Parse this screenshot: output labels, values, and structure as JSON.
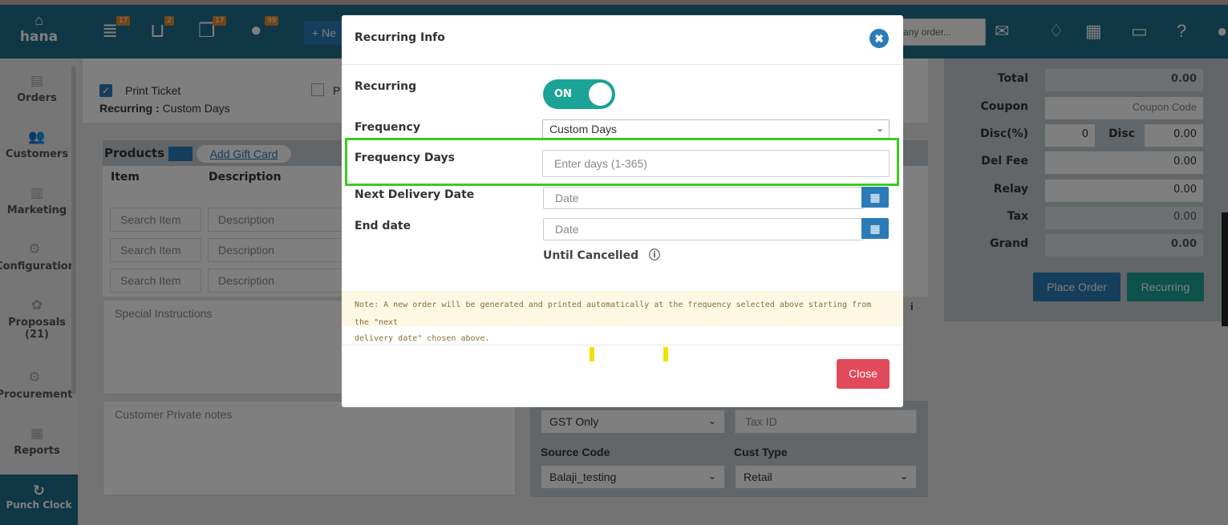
{
  "app": {
    "brand": "hana"
  },
  "sidebar": {
    "items": [
      {
        "label": "Orders",
        "icon": "orders-icon",
        "glyph": "▤"
      },
      {
        "label": "Customers",
        "icon": "customers-icon",
        "glyph": "👥"
      },
      {
        "label": "Marketing",
        "icon": "marketing-icon",
        "glyph": "▥"
      },
      {
        "label": "Configuration",
        "icon": "configuration-icon",
        "glyph": "⚙"
      },
      {
        "label": "Proposals",
        "sublabel": "(21)",
        "icon": "proposals-icon",
        "glyph": "✿"
      },
      {
        "label": "Procurement",
        "icon": "procurement-icon",
        "glyph": "⚙"
      },
      {
        "label": "Reports",
        "icon": "reports-icon",
        "glyph": "▦"
      }
    ],
    "punch_clock": "Punch Clock"
  },
  "header": {
    "badges": [
      "17",
      "2",
      "17",
      "99"
    ],
    "new_label": "+ Ne",
    "search_placeholder": "any order..."
  },
  "order": {
    "print_ticket": "Print Ticket",
    "print_second": "P",
    "recurring_label": "Recurring :",
    "recurring_value": "Custom Days",
    "products_title": "Products",
    "add_gift_card": "Add Gift Card",
    "col_item": "Item",
    "col_description": "Description",
    "search_item": "Search Item",
    "description_placeholder": "Description",
    "special_instructions": "Special Instructions",
    "customer_private_notes": "Customer Private notes",
    "tax_select": "GST Only",
    "tax_id_placeholder": "Tax ID",
    "source_code_label": "Source Code",
    "cust_type_label": "Cust Type",
    "source_code_value": "Balaji_testing",
    "cust_type_value": "Retail"
  },
  "totals": {
    "total_label": "Total",
    "total_value": "0.00",
    "coupon_label": "Coupon",
    "coupon_placeholder": "Coupon Code",
    "disc_pct_label": "Disc(%)",
    "disc_pct_value": "0",
    "disc_label": "Disc",
    "disc_value": "0.00",
    "del_fee_label": "Del Fee",
    "del_fee_value": "0.00",
    "relay_label": "Relay",
    "relay_value": "0.00",
    "tax_label": "Tax",
    "tax_value": "0.00",
    "grand_label": "Grand",
    "grand_value": "0.00",
    "place_order": "Place Order",
    "recurring_btn": "Recurring"
  },
  "modal": {
    "title": "Recurring Info",
    "close_glyph": "✖",
    "recurring_label": "Recurring",
    "toggle_text": "ON",
    "frequency_label": "Frequency",
    "frequency_value": "Custom Days",
    "frequency_days_label": "Frequency Days",
    "frequency_days_placeholder": "Enter days (1-365)",
    "next_delivery_label": "Next Delivery Date",
    "date_placeholder": "Date",
    "end_date_label": "End date",
    "until_cancelled": "Until Cancelled",
    "note_line1": "Note: A new order will be generated and printed automatically at the frequency selected above starting from the \"next",
    "note_line2": "delivery date\" chosen above.",
    "close_button": "Close"
  },
  "colors": {
    "brand": "#1f6f8b",
    "accent": "#2b7bb9",
    "toggle": "#1aa396",
    "danger": "#e14a5a",
    "highlight": "#3ecb21"
  }
}
